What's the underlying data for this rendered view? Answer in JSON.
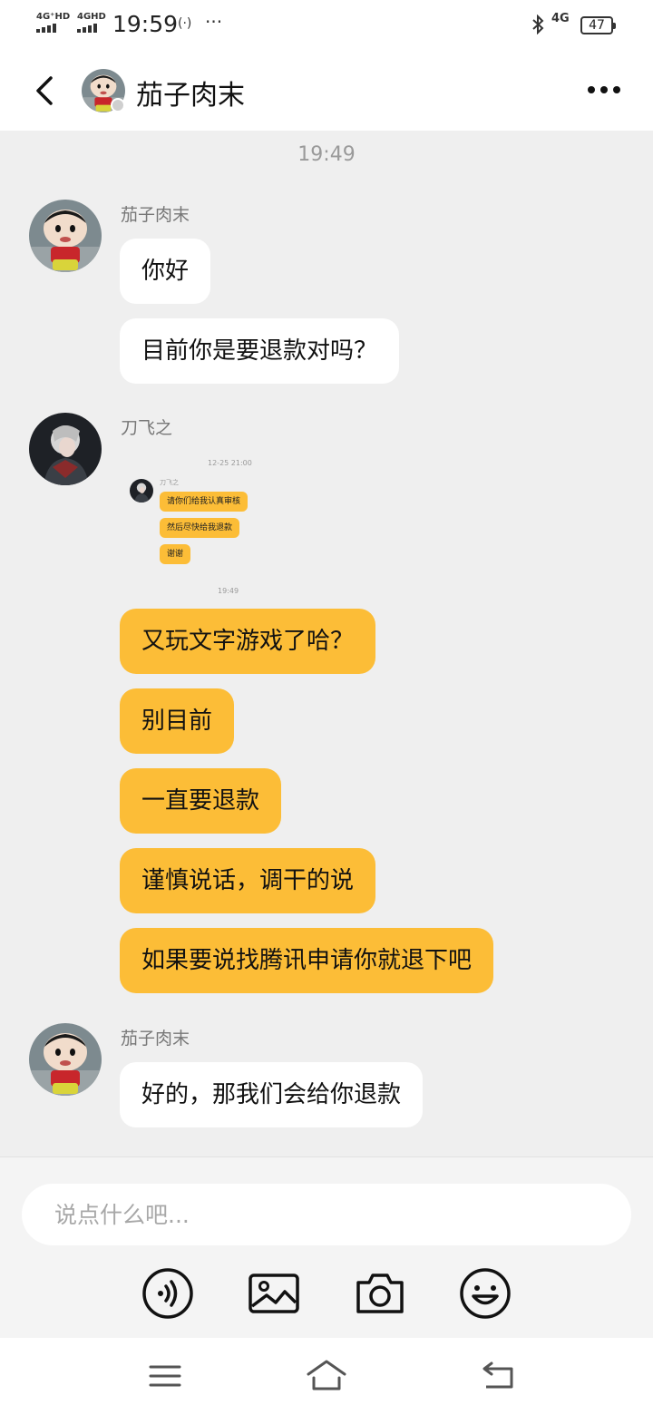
{
  "status_bar": {
    "signal1": "4G⁺HD",
    "signal2": "4GHD",
    "time": "19:59",
    "data_icon": "4G",
    "battery": "47"
  },
  "header": {
    "title": "茄子肉末",
    "back_icon": "chevron-left-icon",
    "more_icon": "more-dots-icon"
  },
  "chat": {
    "timestamp": "19:49",
    "groups": [
      {
        "sender": "茄子肉末",
        "messages": [
          "你好",
          "目前你是要退款对吗？"
        ]
      },
      {
        "sender": "刀飞之",
        "image": {
          "time": "12-25 21:00",
          "sender": "刀飞之",
          "messages": [
            "请你们给我认真审核",
            "然后尽快给我退款",
            "谢谢"
          ],
          "cut_time": "19:49"
        },
        "messages": [
          "又玩文字游戏了哈？",
          "别目前",
          "一直要退款",
          "谨慎说话，调干的说",
          "如果要说找腾讯申请你就退下吧"
        ]
      },
      {
        "sender": "茄子肉末",
        "messages": [
          "好的，那我们会给你退款"
        ]
      }
    ]
  },
  "input": {
    "placeholder": "说点什么吧..."
  },
  "toolbar": {
    "icons": [
      "voice-icon",
      "image-icon",
      "camera-icon",
      "emoji-icon"
    ]
  },
  "nav_bar": {
    "icons": [
      "menu-icon",
      "home-icon",
      "back-icon"
    ]
  },
  "colors": {
    "accent_bubble": "#fcbd37",
    "background": "#efefef",
    "header": "#ffffff"
  }
}
